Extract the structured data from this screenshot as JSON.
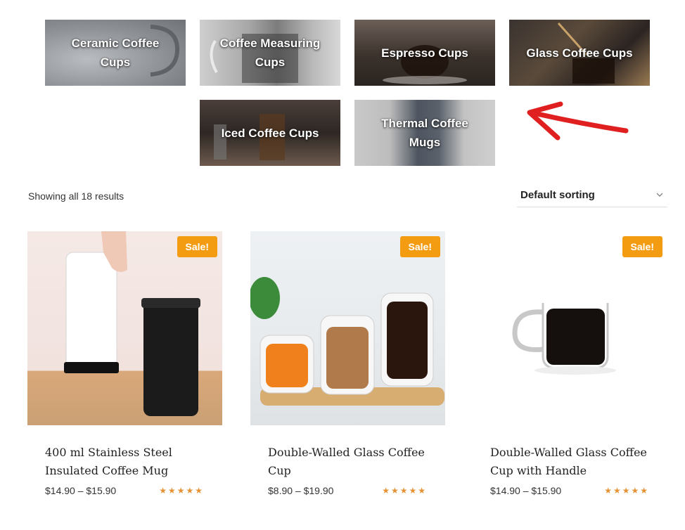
{
  "categories": [
    {
      "label": "Ceramic Coffee Cups"
    },
    {
      "label": "Coffee Measuring Cups"
    },
    {
      "label": "Espresso Cups"
    },
    {
      "label": "Glass Coffee Cups"
    },
    {
      "label": "Iced Coffee Cups"
    },
    {
      "label": "Thermal Coffee Mugs"
    }
  ],
  "toolbar": {
    "result_count": "Showing all 18 results",
    "sorting_selected": "Default sorting",
    "sorting_icon": "chevron-down-icon"
  },
  "annotation": {
    "icon": "red-arrow-icon",
    "color": "#e02020"
  },
  "products": [
    {
      "badge": "Sale!",
      "title": "400 ml Stainless Steel Insulated Coffee Mug",
      "price": "$14.90 – $15.90",
      "rating": "★★★★★",
      "rating_value": 5
    },
    {
      "badge": "Sale!",
      "title": "Double-Walled Glass Coffee Cup",
      "price": "$8.90 – $19.90",
      "rating": "★★★★★",
      "rating_value": 5
    },
    {
      "badge": "Sale!",
      "title": "Double-Walled Glass Coffee Cup with Handle",
      "price": "$14.90 – $15.90",
      "rating": "★★★★★",
      "rating_value": 5
    }
  ],
  "colors": {
    "accent": "#f39c12",
    "star": "#e59234",
    "text": "#222222"
  }
}
